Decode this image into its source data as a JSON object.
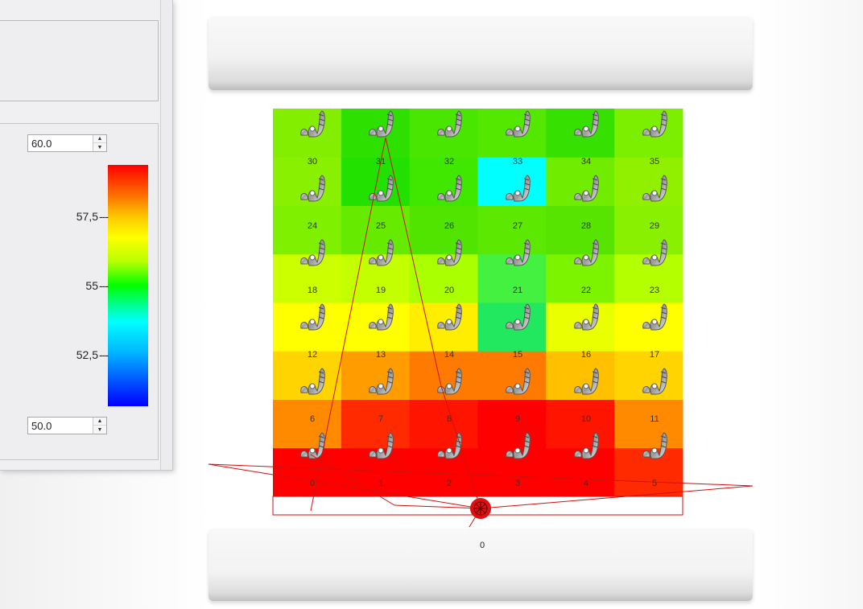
{
  "legend_panel": {
    "max_value": "60.0",
    "min_value": "50.0",
    "tick_labels": [
      "57,5",
      "55",
      "52,5"
    ],
    "tick_dash": "---"
  },
  "scene": {
    "station_label": "0",
    "grid_columns": 6,
    "grid_rows": 6,
    "cell_labels": [
      "0",
      "1",
      "2",
      "3",
      "4",
      "5",
      "6",
      "7",
      "8",
      "9",
      "10",
      "11",
      "12",
      "13",
      "14",
      "15",
      "16",
      "17",
      "18",
      "19",
      "20",
      "21",
      "22",
      "23",
      "24",
      "25",
      "26",
      "27",
      "28",
      "29",
      "30",
      "31",
      "32",
      "33",
      "34",
      "35"
    ],
    "cell_colors": [
      [
        "#ff0000",
        "#ff0000",
        "#ff0000",
        "#ff0000",
        "#ff0000",
        "#ff2a00"
      ],
      [
        "#ff8a00",
        "#ff2a00",
        "#ff1400",
        "#ff0000",
        "#ff1400",
        "#ff8a00"
      ],
      [
        "#ffd400",
        "#ff9c00",
        "#ff7a00",
        "#ff7a00",
        "#ffc000",
        "#ffd400"
      ],
      [
        "#ffff00",
        "#ffff00",
        "#ffee00",
        "#22e860",
        "#eaff00",
        "#ffff00"
      ],
      [
        "#ccff00",
        "#c4ff00",
        "#aaff00",
        "#44f040",
        "#7cf400",
        "#b4ff00"
      ],
      [
        "#7ef000",
        "#66ea00",
        "#50e400",
        "#5ce800",
        "#56e400",
        "#88f000"
      ],
      [
        "#88f000",
        "#22e000",
        "#40e800",
        "#00ffff",
        "#70ec00",
        "#90f000"
      ],
      [
        "#84ee00",
        "#2ee000",
        "#48e600",
        "#54e800",
        "#36e000",
        "#7cee00"
      ]
    ]
  }
}
